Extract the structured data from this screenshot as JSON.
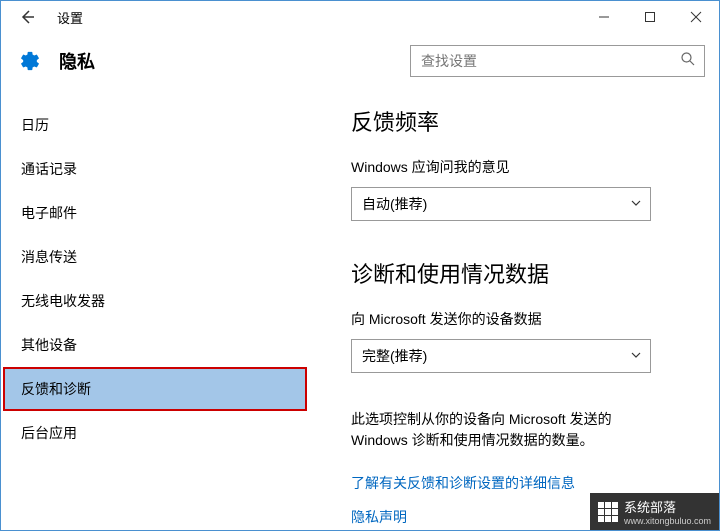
{
  "window": {
    "title": "设置"
  },
  "header": {
    "page_title": "隐私",
    "search_placeholder": "查找设置"
  },
  "sidebar": {
    "items": [
      {
        "label": "日历"
      },
      {
        "label": "通话记录"
      },
      {
        "label": "电子邮件"
      },
      {
        "label": "消息传送"
      },
      {
        "label": "无线电收发器"
      },
      {
        "label": "其他设备"
      },
      {
        "label": "反馈和诊断"
      },
      {
        "label": "后台应用"
      }
    ]
  },
  "main": {
    "section1": {
      "title": "反馈频率",
      "label": "Windows 应询问我的意见",
      "select_value": "自动(推荐)"
    },
    "section2": {
      "title": "诊断和使用情况数据",
      "label": "向 Microsoft 发送你的设备数据",
      "select_value": "完整(推荐)",
      "description": "此选项控制从你的设备向 Microsoft 发送的 Windows 诊断和使用情况数据的数量。",
      "link1": "了解有关反馈和诊断设置的详细信息",
      "link2": "隐私声明"
    }
  },
  "watermark": {
    "name": "系统部落",
    "url": "www.xitongbuluo.com"
  }
}
